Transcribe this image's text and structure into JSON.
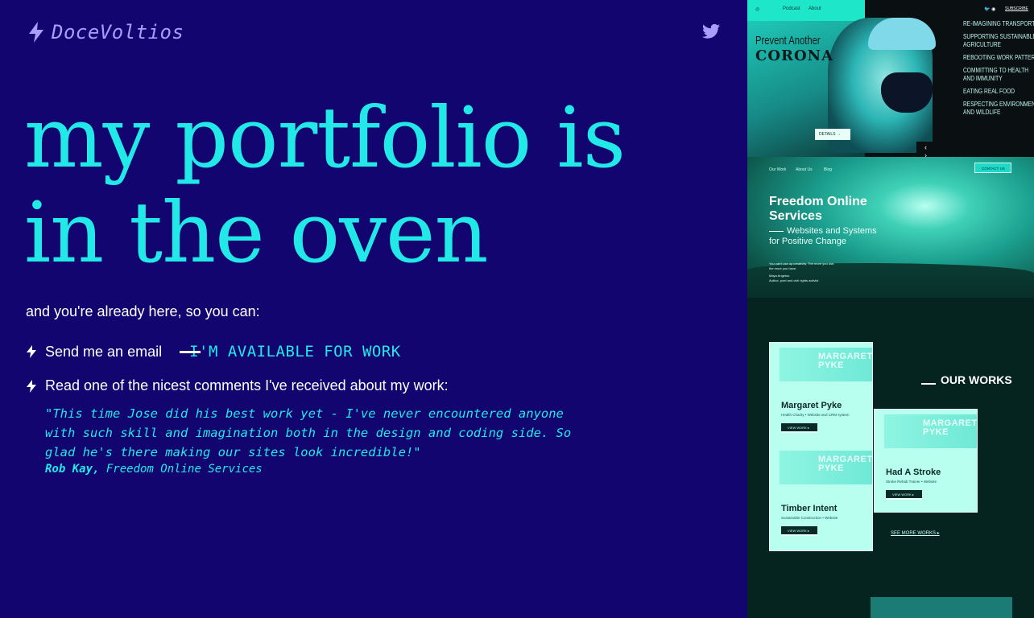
{
  "header": {
    "logo_text": "DoceVoltios",
    "logo_icon": "lightning-bolt-icon",
    "social_icon": "twitter-icon"
  },
  "hero": {
    "line1": "my portfolio is",
    "line2": "in the oven"
  },
  "intro": "and you're already here, so you can:",
  "actions": {
    "email_label": "Send me an email",
    "available_label": "I'M AVAILABLE FOR WORK",
    "comment_label": "Read one of the nicest comments I've received about my work:"
  },
  "testimonial": {
    "quote": "\"This time Jose did his best work yet - I've never encountered anyone with such skill and imagination both in the design and coding side. So glad he's there making our sites look incredible!\"",
    "author": "Rob Kay,",
    "company": "Freedom Online Services"
  },
  "shots": {
    "corona": {
      "nav_podcast": "Podcast",
      "nav_about": "About",
      "title_a": "Prevent Another",
      "title_b": "CORONA",
      "details": "DETAILS →",
      "arrows": "‹ ›",
      "subscribe": "SUBSCRIBE",
      "icons": "🐦 ◉",
      "list": [
        "Re-Imagining Transport",
        "Supporting Sustainable",
        "Agriculture",
        "Rebooting Work Patterns",
        "Committing to Health",
        "and Immunity",
        "Eating Real Food",
        "Respecting Environment",
        "and Wildlife"
      ]
    },
    "freedom": {
      "nav": [
        "Our Work",
        "About Us",
        "Blog"
      ],
      "contact": "CONTACT US",
      "title1": "Freedom Online",
      "title2": "Services",
      "sub1": "Websites and Systems",
      "sub2": "for Positive Change",
      "small1": "You can't use up creativity. The more you use,",
      "small2": "the more you have.",
      "small3": "Maya Angelou",
      "small4": "Author, poet and civil rights activist"
    },
    "works": {
      "heading": "OUR WORKS",
      "see_more": "SEE MORE WORKS ▸",
      "thumb_label": "MARGARET PYKE",
      "cards": [
        {
          "title": "Margaret Pyke",
          "meta": "Health Charity  •  Website and CRM system",
          "button": "VIEW WORK ▸"
        },
        {
          "title": "Had A Stroke",
          "meta": "Stroke Rehab Trainer  •  Website",
          "button": "VIEW WORK ▸"
        },
        {
          "title": "Timber Intent",
          "meta": "Sustainable Construction  •  Website",
          "button": "VIEW WORK ▸"
        }
      ]
    }
  },
  "colors": {
    "background": "#120570",
    "accent": "#22e8e8",
    "logo": "#a99dff"
  }
}
